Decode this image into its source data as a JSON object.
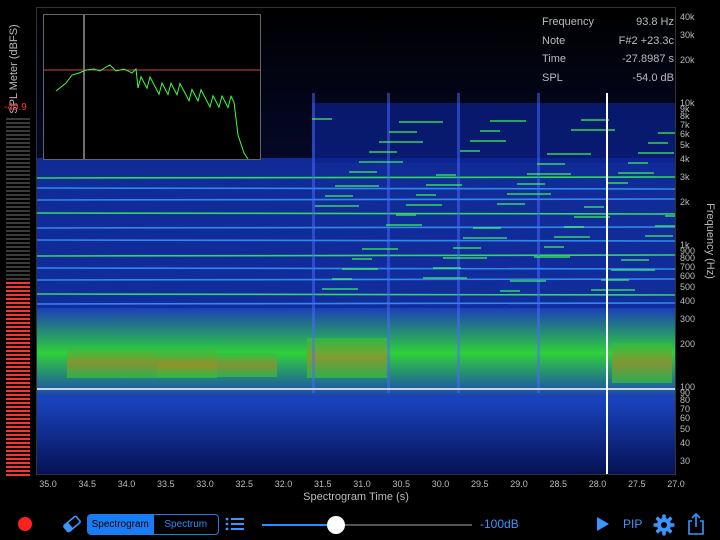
{
  "spl": {
    "title": "SPL Meter (dBFS)",
    "value": "-40.9",
    "level_fraction": 0.54,
    "active_color": "#ff3030",
    "inactive_color": "#3a3a3a"
  },
  "readout": {
    "frequency_label": "Frequency",
    "frequency_value": "93.8 Hz",
    "note_label": "Note",
    "note_value": "F#2 +23.3c",
    "time_label": "Time",
    "time_value": "-27.8987 s",
    "spl_label": "SPL",
    "spl_value": "-54.0 dB"
  },
  "frequency_axis": {
    "title": "Frequency (Hz)",
    "ticks": [
      "40k",
      "30k",
      "20k",
      "10k",
      "9k",
      "8k",
      "7k",
      "6k",
      "5k",
      "4k",
      "3k",
      "2k",
      "1k",
      "900",
      "800",
      "700",
      "600",
      "500",
      "400",
      "300",
      "200",
      "100",
      "90",
      "80",
      "70",
      "60",
      "50",
      "40",
      "30"
    ]
  },
  "time_axis": {
    "title": "Spectrogram Time (s)",
    "ticks": [
      "35.0",
      "34.5",
      "34.0",
      "33.5",
      "33.0",
      "32.5",
      "32.0",
      "31.5",
      "31.0",
      "30.5",
      "30.0",
      "29.5",
      "29.0",
      "28.5",
      "28.0",
      "27.5",
      "27.0"
    ]
  },
  "toolbar": {
    "mode_spectrogram": "Spectrogram",
    "mode_spectrum": "Spectrum",
    "range_label": "-100dB",
    "range_fraction": 0.35,
    "pip_label": "PIP",
    "accent": "#1a7cf3"
  },
  "colors": {
    "spectrogram_low": "#0a1a8a",
    "spectrogram_mid": "#1f8a2a",
    "spectrogram_high": "#8a7a20",
    "cursor": "#ffffff",
    "inset_trace": "#3dff3d",
    "inset_reference": "#d04040"
  }
}
